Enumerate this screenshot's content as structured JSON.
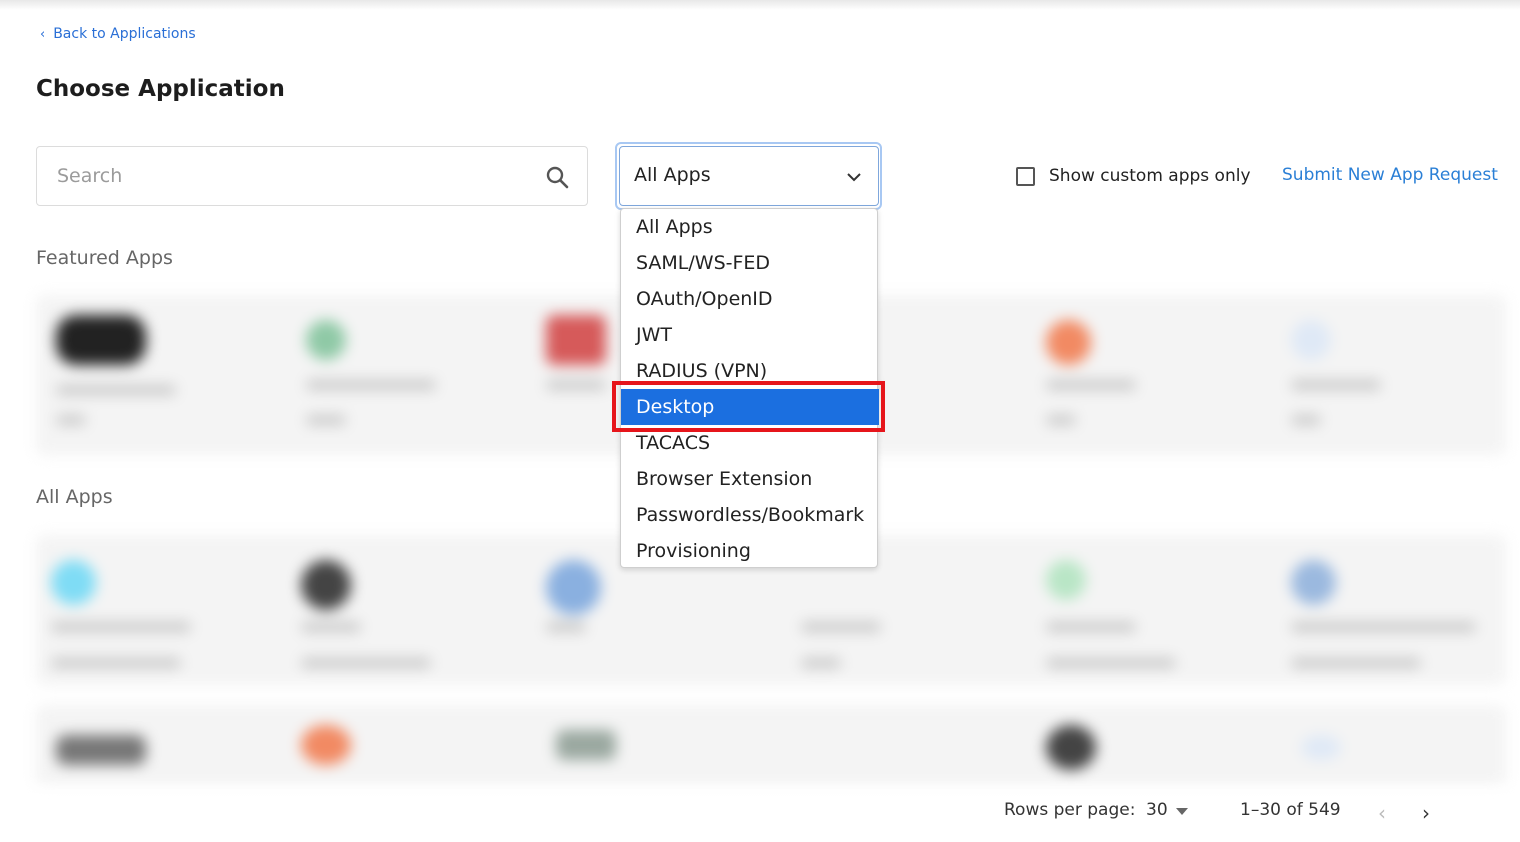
{
  "header": {
    "back_label": "Back to Applications",
    "title": "Choose Application"
  },
  "search": {
    "placeholder": "Search",
    "icon": "search-icon"
  },
  "filter": {
    "selected": "All Apps",
    "options": [
      "All Apps",
      "SAML/WS-FED",
      "OAuth/OpenID",
      "JWT",
      "RADIUS (VPN)",
      "Desktop",
      "TACACS",
      "Browser Extension",
      "Passwordless/Bookmark",
      "Provisioning"
    ],
    "highlighted": "Desktop"
  },
  "custom_apps": {
    "label": "Show custom apps only",
    "checked": false
  },
  "submit_link": "Submit New App Request",
  "sections": {
    "featured": "Featured Apps",
    "all": "All Apps"
  },
  "pagination": {
    "rows_label": "Rows per page:",
    "rows_value": "30",
    "range": "1–30 of 549"
  },
  "colors": {
    "accent": "#1b6fe0",
    "link": "#2a6fd6",
    "highlight_border": "#e6151b"
  }
}
